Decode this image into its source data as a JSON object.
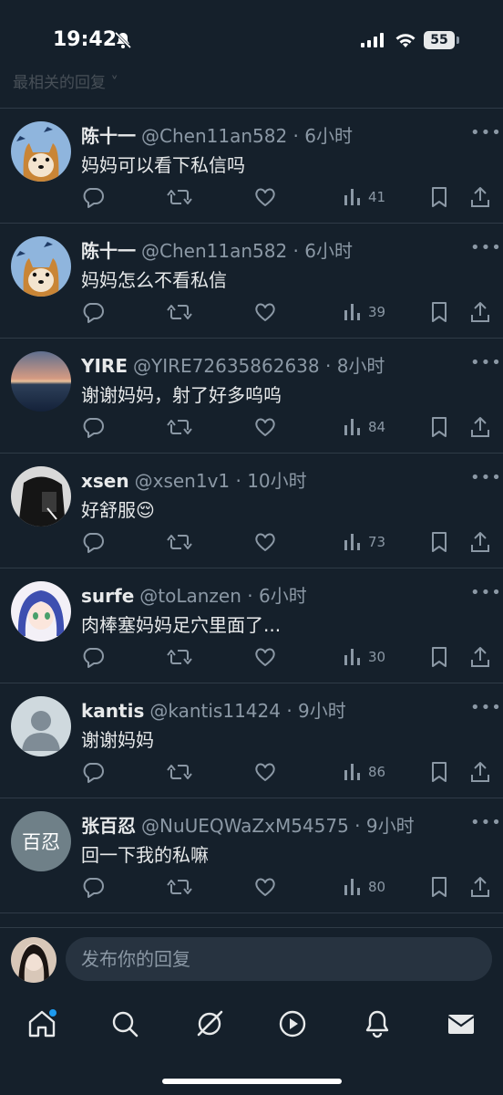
{
  "status_bar": {
    "time": "19:42",
    "battery": "55"
  },
  "sort_label": "最相关的回复 ˅",
  "replies": [
    {
      "name": "陈十一",
      "handle": "@Chen11an582 · 6小时",
      "text": "妈妈可以看下私信吗",
      "views": "41",
      "avatar_type": "shiba"
    },
    {
      "name": "陈十一",
      "handle": "@Chen11an582 · 6小时",
      "text": "妈妈怎么不看私信",
      "views": "39",
      "avatar_type": "shiba"
    },
    {
      "name": "YIRE",
      "handle": "@YIRE72635862638 · 8小时",
      "text": "谢谢妈妈，射了好多呜呜",
      "views": "84",
      "avatar_type": "sunset"
    },
    {
      "name": "xsen",
      "handle": "@xsen1v1 · 10小时",
      "text": "好舒服😌",
      "views": "73",
      "avatar_type": "dark"
    },
    {
      "name": "surfe",
      "handle": "@toLanzen · 6小时",
      "text": "肉棒塞妈妈足穴里面了...",
      "views": "30",
      "avatar_type": "anime"
    },
    {
      "name": "kantis",
      "handle": "@kantis11424 · 9小时",
      "text": "谢谢妈妈",
      "views": "86",
      "avatar_type": "default"
    },
    {
      "name": "张百忍",
      "handle": "@NuUEQWaZxM54575 · 9小时",
      "text": "回一下我的私嘛",
      "views": "80",
      "avatar_type": "text",
      "avatar_text": "百忍"
    }
  ],
  "reply_input": {
    "placeholder": "发布你的回复"
  },
  "tabbar": {
    "items": [
      "home-icon",
      "search-icon",
      "grok-icon",
      "video-icon",
      "notifications-icon",
      "messages-icon"
    ]
  }
}
